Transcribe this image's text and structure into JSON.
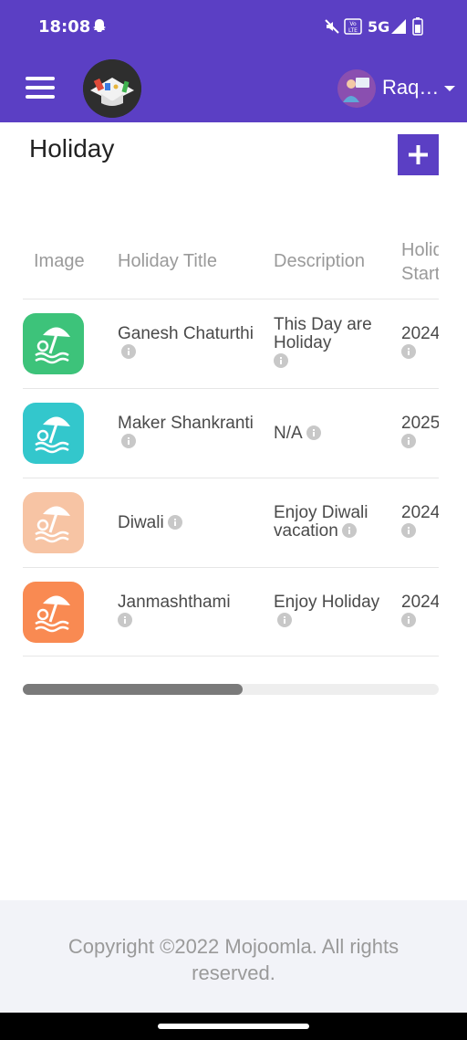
{
  "status_bar": {
    "time": "18:08",
    "network": "5G",
    "volte": "Vo LTE",
    "icons": [
      "snapchat-ghost-icon",
      "mute-icon",
      "volte-icon",
      "signal-icon",
      "battery-icon"
    ]
  },
  "app_bar": {
    "user_name": "Raq…",
    "colors": {
      "brand": "#5b3fc4"
    }
  },
  "page": {
    "title": "Holiday",
    "add_label": "+"
  },
  "table": {
    "columns": [
      "Image",
      "Holiday Title",
      "Description",
      "Holiday Start"
    ],
    "rows": [
      {
        "title": "Ganesh Chaturthi",
        "description": "This Day are Holiday",
        "start": "2024",
        "image_color": "#3dc37a"
      },
      {
        "title": "Maker Shankranti",
        "description": "N/A",
        "start": "2025",
        "image_color": "#33c7cc"
      },
      {
        "title": "Diwali",
        "description": "Enjoy Diwali vacation",
        "start": "2024",
        "image_color": "#f7c4a4"
      },
      {
        "title": "Janmashthami",
        "description": "Enjoy Holiday",
        "start": "2024",
        "image_color": "#f98a52"
      }
    ],
    "horizontal_scroll_fraction": 0.53
  },
  "footer": {
    "copyright": "Copyright ©2022 Mojoomla. All rights reserved."
  }
}
